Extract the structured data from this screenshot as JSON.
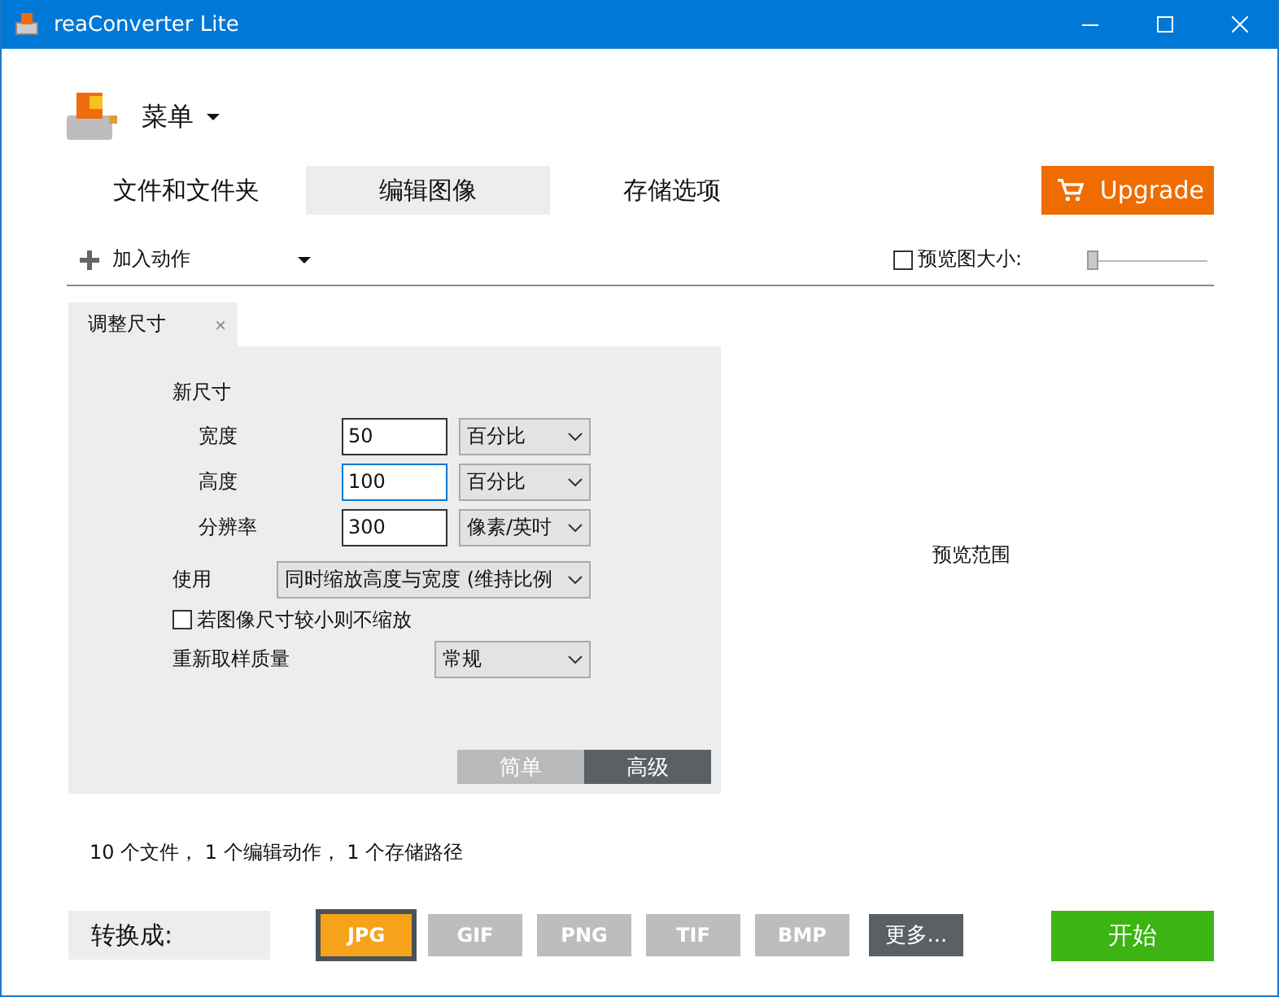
{
  "window": {
    "title": "reaConverter Lite"
  },
  "menu": {
    "label": "菜单"
  },
  "tabs": [
    {
      "label": "文件和文件夹",
      "selected": false
    },
    {
      "label": "编辑图像",
      "selected": true
    },
    {
      "label": "存储选项",
      "selected": false
    }
  ],
  "upgrade_button": "Upgrade",
  "toolbar": {
    "add_action": "加入动作",
    "preview_size": {
      "label": "预览图大小:",
      "checked": false,
      "level": 0.0
    }
  },
  "action_tab": {
    "label": "调整尺寸",
    "close": "×"
  },
  "resize": {
    "heading": "新尺寸",
    "rows": [
      {
        "label": "宽度",
        "value": "50",
        "unit": "百分比",
        "focused": false
      },
      {
        "label": "高度",
        "value": "100",
        "unit": "百分比",
        "focused": true
      },
      {
        "label": "分辨率",
        "value": "300",
        "unit": "像素/英吋",
        "focused": false
      }
    ],
    "use_label": "使用",
    "use_value": "同时缩放高度与宽度 (维持比例",
    "no_upscale": {
      "label": "若图像尺寸较小则不缩放",
      "checked": false
    },
    "quality_label": "重新取样质量",
    "quality_value": "常规",
    "modes": [
      {
        "label": "简单",
        "selected": false
      },
      {
        "label": "高级",
        "selected": true
      }
    ]
  },
  "preview_area": "预览范围",
  "status": "10 个文件， 1 个编辑动作， 1 个存储路径",
  "convert_label": "转换成:",
  "formats": [
    {
      "label": "JPG",
      "selected": true
    },
    {
      "label": "GIF",
      "selected": false
    },
    {
      "label": "PNG",
      "selected": false
    },
    {
      "label": "TIF",
      "selected": false
    },
    {
      "label": "BMP",
      "selected": false
    }
  ],
  "more_button": "更多...",
  "start_button": "开始"
}
